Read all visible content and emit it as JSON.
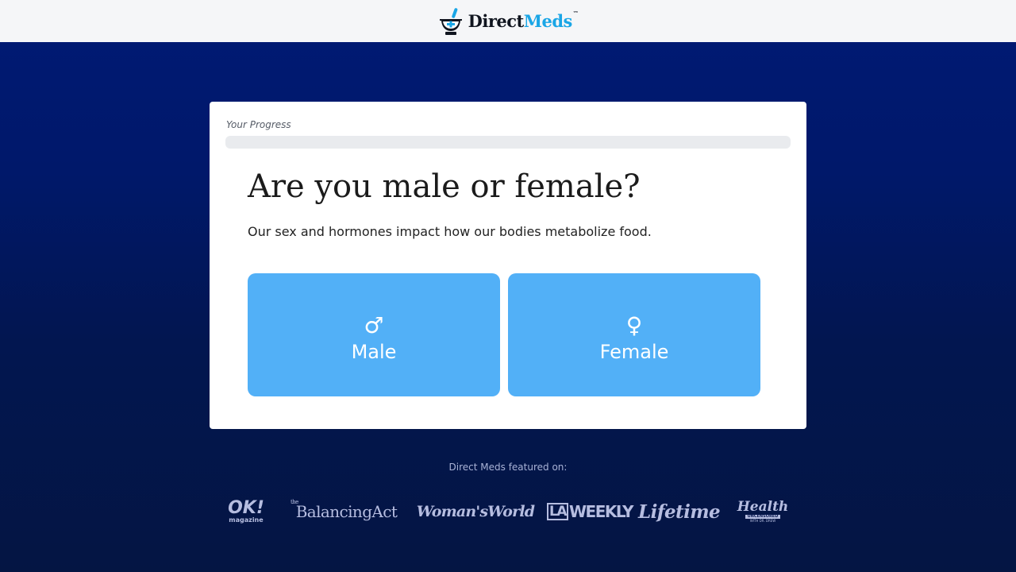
{
  "header": {
    "logo_direct": "Direct",
    "logo_meds": "Meds",
    "logo_tm": "™",
    "logo_icon": "mortar-pestle-icon"
  },
  "progress": {
    "label": "Your Progress",
    "value": 0
  },
  "question": {
    "title": "Are you male or female?",
    "subtitle": "Our sex and hormones impact how our bodies metabolize food."
  },
  "options": [
    {
      "icon": "♂",
      "icon_name": "male-symbol-icon",
      "label": "Male"
    },
    {
      "icon": "♀",
      "icon_name": "female-symbol-icon",
      "label": "Female"
    }
  ],
  "featured": {
    "label": "Direct Meds featured on:",
    "logos": {
      "ok_big": "OK!",
      "ok_small": "magazine",
      "balancing_the": "the",
      "balancing": "BalancingAct",
      "womans_world": "Woman'sWorld",
      "la": "LA",
      "weekly": "WEEKLY",
      "lifetime": "Lifetime",
      "health_1": "Health",
      "health_2": "UNCENSORED",
      "health_3": "WITH DR. DREW"
    }
  },
  "colors": {
    "brand_accent": "#1aa6e6",
    "option_bg": "#52b0f7",
    "page_bg_top": "#001a75",
    "page_bg_bottom": "#041543"
  }
}
